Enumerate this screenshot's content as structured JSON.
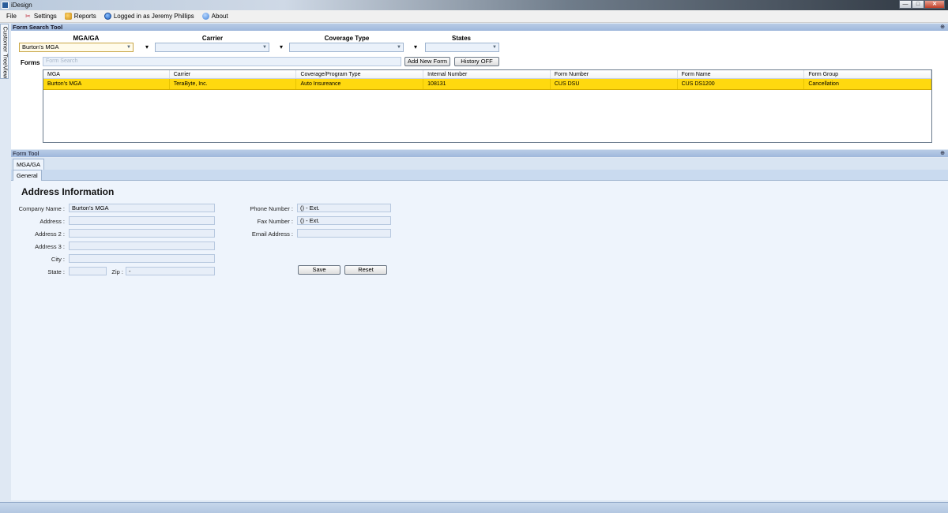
{
  "window": {
    "title": "iDesign"
  },
  "menu": {
    "file": "File",
    "settings": "Settings",
    "reports": "Reports",
    "logged_in": "Logged in as Jeremy Phillips",
    "about": "About"
  },
  "sidetab": {
    "label": "Customer TreeView"
  },
  "search_panel": {
    "header": "Form Search Tool",
    "labels": {
      "mga": "MGA/GA",
      "carrier": "Carrier",
      "coverage": "Coverage Type",
      "states": "States"
    },
    "mga_value": "Burton's MGA",
    "carrier_value": "",
    "coverage_value": "",
    "states_value": "",
    "forms_label": "Forms",
    "search_placeholder": "Form Search",
    "add_new_form": "Add New Form",
    "history": "History OFF"
  },
  "grid": {
    "columns": [
      "MGA",
      "Carrier",
      "Coverage/Program Type",
      "Internal Number",
      "Form Number",
      "Form Name",
      "Form Group"
    ],
    "rows": [
      [
        "Burton's MGA",
        "TeraByte, Inc.",
        "Auto Insureance",
        "108131",
        "CUS DSU",
        "CUS DS1200",
        "Cancellation"
      ]
    ]
  },
  "form_tool": {
    "header": "Form Tool",
    "tab_outer": "MGA/GA",
    "tab_inner": "General",
    "section_title": "Address Information",
    "labels": {
      "company_name": "Company Name :",
      "address": "Address :",
      "address2": "Address 2 :",
      "address3": "Address 3 :",
      "city": "City :",
      "state": "State :",
      "zip": "Zip :",
      "phone": "Phone Number :",
      "fax": "Fax Number :",
      "email": "Email Address :"
    },
    "values": {
      "company_name": "Burton's MGA",
      "address": "",
      "address2": "",
      "address3": "",
      "city": "",
      "state": "",
      "zip": "-",
      "phone": "() - Ext.",
      "fax": "() - Ext.",
      "email": ""
    },
    "save": "Save",
    "reset": "Reset"
  }
}
